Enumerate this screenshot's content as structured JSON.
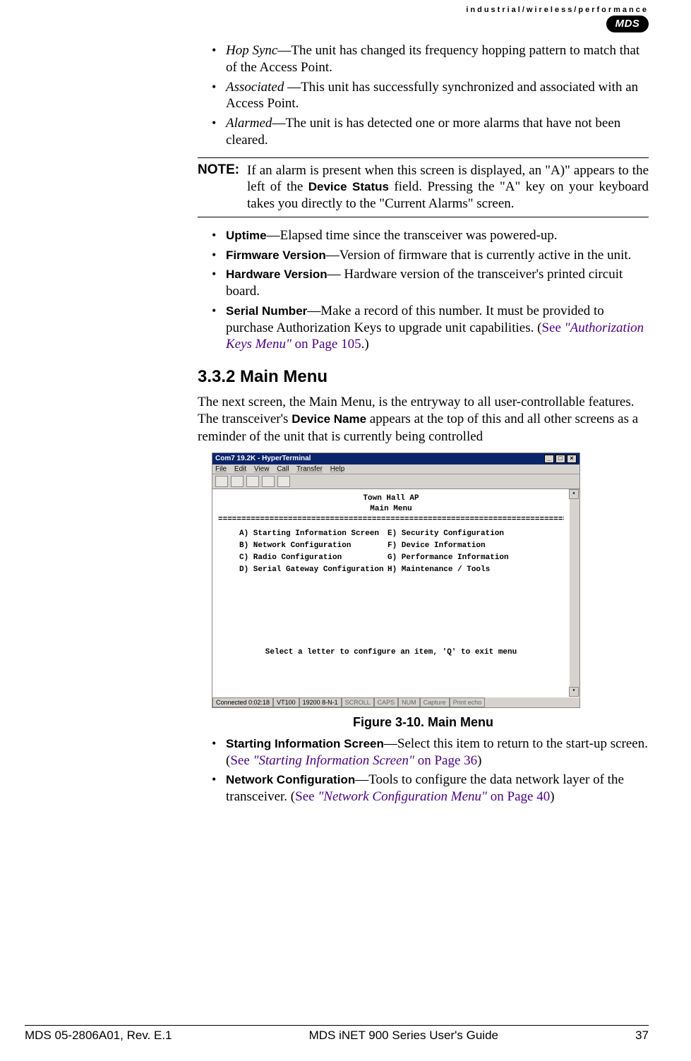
{
  "header": {
    "tagline": "industrial/wireless/performance",
    "logo_text": "MDS"
  },
  "list1": [
    {
      "term": "Hop Sync",
      "desc": "—The unit has changed its frequency hopping pattern to match that of the Access Point."
    },
    {
      "term": "Associated ",
      "desc": "—This unit has successfully synchronized and associated with an Access Point."
    },
    {
      "term": "Alarmed",
      "desc": "—The unit is has detected one or more alarms that have not been cleared."
    }
  ],
  "note": {
    "label": "NOTE:",
    "body_pre": "If an alarm is present when this screen is displayed, an \"A)\" appears to the left of the ",
    "body_bold": "Device Status",
    "body_post": " field. Pressing the \"A\" key on your keyboard takes you directly to the \"Current Alarms\" screen."
  },
  "list2": [
    {
      "term": "Uptime",
      "desc": "—Elapsed time since the transceiver was powered-up."
    },
    {
      "term": "Firmware Version",
      "desc": "—Version of firmware that is currently active in the unit."
    },
    {
      "term": "Hardware Version",
      "desc": "— Hardware version of the transceiver's printed circuit board."
    }
  ],
  "serial_item": {
    "term": "Serial Number",
    "desc_pre": "—Make a record of this number. It must be provided to purchase Authorization Keys to upgrade unit capabilities. (",
    "see": "See ",
    "link_italic": "\"Authorization Keys Menu\"",
    "link_page": " on Page 105",
    "desc_post": ".)"
  },
  "section_heading": "3.3.2 Main Menu",
  "para1_pre": "The next screen, the Main Menu, is the entryway to all user-controllable features. The transceiver's ",
  "para1_bold": "Device Name",
  "para1_post": " appears at the top of this and all other screens as a reminder of the unit that is currently being controlled",
  "terminal": {
    "title": "Com7 19.2K - HyperTerminal",
    "menus": [
      "File",
      "Edit",
      "View",
      "Call",
      "Transfer",
      "Help"
    ],
    "header1": "Town Hall AP",
    "header2": "Main Menu",
    "divider": "==============================================================================",
    "left": [
      "A) Starting Information Screen",
      "B) Network Configuration",
      "C) Radio Configuration",
      "D) Serial Gateway Configuration"
    ],
    "right": [
      "E) Security Configuration",
      "F) Device Information",
      "G) Performance Information",
      "H) Maintenance / Tools"
    ],
    "prompt": "Select a letter to configure an item, 'Q' to exit menu",
    "status": {
      "connected": "Connected 0:02:18",
      "emul": "VT100",
      "baud": "19200 8-N-1",
      "s1": "SCROLL",
      "s2": "CAPS",
      "s3": "NUM",
      "s4": "Capture",
      "s5": "Print echo"
    }
  },
  "figure_caption": "Figure 3-10. Main Menu",
  "list3a": {
    "term": "Starting Information Screen",
    "desc_pre": "—Select this item to return to the start-up screen. (",
    "see": "See ",
    "link_italic": "\"Starting Information Screen\"",
    "link_page": " on Page 36",
    "desc_post": ")"
  },
  "list3b": {
    "term": "Network Configuration",
    "desc_pre": "—Tools to configure the data network layer of the transceiver. (",
    "see": "See ",
    "link_italic": "\"Network Conﬁguration Menu\"",
    "link_page": " on Page 40",
    "desc_post": ")"
  },
  "footer": {
    "left": "MDS 05-2806A01, Rev. E.1",
    "center": "MDS iNET 900 Series User's Guide",
    "right": "37"
  }
}
